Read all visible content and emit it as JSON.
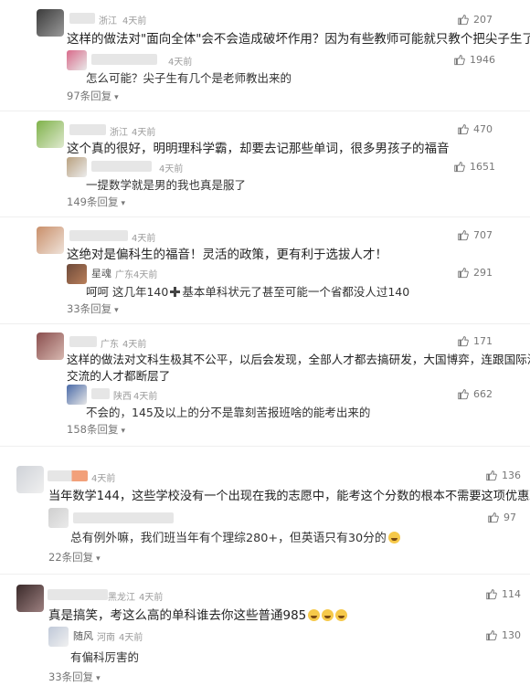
{
  "comments": [
    {
      "location": "浙江",
      "time": "4天前",
      "text": "这样的做法对\"面向全体\"会不会造成破坏作用？因为有些教师可能就只教个把尖子生了。",
      "likes": "207",
      "reply": {
        "location": "",
        "time": "4天前",
        "text": "怎么可能？尖子生有几个是老师教出来的",
        "likes": "1946"
      },
      "reply_count": "97条回复"
    },
    {
      "location": "浙江",
      "time": "4天前",
      "text": "这个真的很好，明明理科学霸，却要去记那些单词，很多男孩子的福音",
      "likes": "470",
      "reply": {
        "location": "",
        "time": "4天前",
        "text": "一提数学就是男的我也真是服了",
        "likes": "1651"
      },
      "reply_count": "149条回复"
    },
    {
      "location": "",
      "time": "4天前",
      "text": "这绝对是偏科生的福音！灵活的政策，更有利于选拔人才！",
      "likes": "707",
      "reply": {
        "name": "星魂",
        "location": "广东",
        "time": "4天前",
        "text_before": "呵呵 这几年140",
        "text_after": "基本单科状元了甚至可能一个省都没人过140",
        "likes": "291"
      },
      "reply_count": "33条回复"
    },
    {
      "location": "广东",
      "time": "4天前",
      "text": "这样的做法对文科生极其不公平，以后会发现，全部人才都去搞研发，大国博弈，连跟国际沟通",
      "text2": "交流的人才都断层了",
      "likes": "171",
      "reply": {
        "location": "陕西",
        "time": "4天前",
        "text": "不会的，145及以上的分不是靠刻苦报班啥的能考出来的",
        "likes": "662"
      },
      "reply_count": "158条回复"
    },
    {
      "location": "",
      "time": "4天前",
      "text": "当年数学144，这些学校没有一个出现在我的志愿中，能考这个分数的根本不需要这项优惠政策",
      "likes": "136",
      "reply": {
        "location": "",
        "time": "",
        "text": "总有例外嘛，我们班当年有个理综280+，但英语只有30分的",
        "likes": "97"
      },
      "reply_count": "22条回复"
    },
    {
      "location": "黑龙江",
      "time": "4天前",
      "text": "真是搞笑，考这么高的单科谁去你这些普通985",
      "likes": "114",
      "reply": {
        "name": "随风",
        "location": "河南",
        "time": "4天前",
        "text": "有偏科厉害的",
        "likes": "130"
      },
      "reply_count": "33条回复"
    }
  ],
  "colors": {
    "meta": "#9a9a9a",
    "text": "#333333",
    "accent": "#555555"
  }
}
